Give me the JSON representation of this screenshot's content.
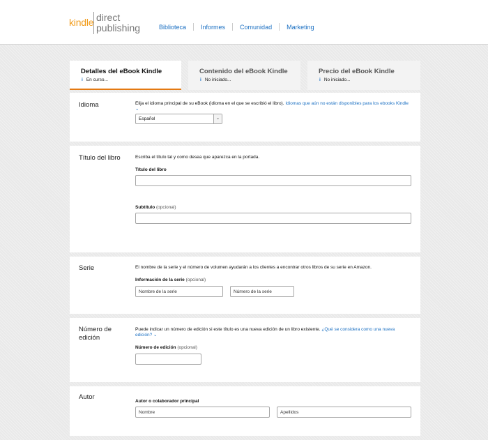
{
  "logo": {
    "kindle": "kindle",
    "direct": "direct",
    "publishing": "publishing"
  },
  "nav": [
    "Biblioteca",
    "Informes",
    "Comunidad",
    "Marketing"
  ],
  "tabs": [
    {
      "title": "Detalles del eBook Kindle",
      "status": "En curso..."
    },
    {
      "title": "Contenido del eBook Kindle",
      "status": "No iniciado..."
    },
    {
      "title": "Precio del eBook Kindle",
      "status": "No iniciado..."
    }
  ],
  "status_icon": "info-icon",
  "accent_color": "#e47911",
  "link_color": "#1a6fc2",
  "idioma": {
    "label": "Idioma",
    "desc": "Elija el idioma principal de su eBook (idioma en el que se escribió el libro).",
    "link": "Idiomas que aún no están disponibles para los ebooks Kindle",
    "link_icon": "chevron-down-icon",
    "select_value": "Español"
  },
  "titulo": {
    "label": "Título del libro",
    "desc": "Escriba el título tal y como desea que aparezca en la portada.",
    "title_field_label": "Título del libro",
    "subtitle_field_label": "Subtítulo",
    "optional": "(opcional)",
    "title_value": "",
    "subtitle_value": ""
  },
  "serie": {
    "label": "Serie",
    "desc": "El nombre de la serie y el número de volumen ayudarán a los clientes a encontrar otros libros de su serie en Amazon.",
    "field_label": "Información de la serie",
    "optional": "(opcional)",
    "name_placeholder": "Nombre de la serie",
    "number_placeholder": "Número de la serie"
  },
  "edicion": {
    "label": "Número de edición",
    "desc": "Puede indicar un número de edición si este título es una nueva edición de un libro existente.",
    "link": "¿Qué se considera como una nueva edición?",
    "field_label": "Número de edición",
    "optional": "(opcional)",
    "value": ""
  },
  "autor": {
    "label": "Autor",
    "field_label": "Autor o colaborador principal",
    "first_placeholder": "Nombre",
    "last_placeholder": "Apellidos"
  }
}
